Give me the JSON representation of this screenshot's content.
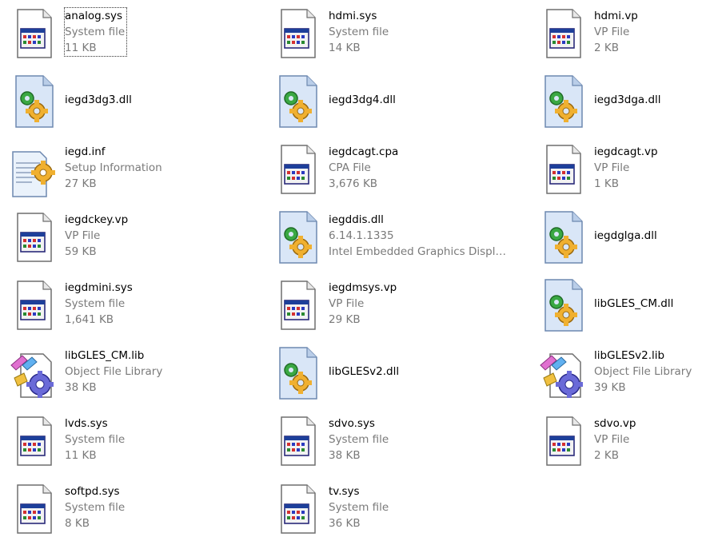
{
  "files": [
    {
      "name": "analog.sys",
      "line2": "System file",
      "line3": "11 KB",
      "icon": "system-file-icon",
      "selected": true
    },
    {
      "name": "hdmi.sys",
      "line2": "System file",
      "line3": "14 KB",
      "icon": "system-file-icon"
    },
    {
      "name": "hdmi.vp",
      "line2": "VP File",
      "line3": "2 KB",
      "icon": "system-file-icon"
    },
    {
      "name": "iegd3dg3.dll",
      "line2": "",
      "line3": "",
      "icon": "dll-file-icon"
    },
    {
      "name": "iegd3dg4.dll",
      "line2": "",
      "line3": "",
      "icon": "dll-file-icon"
    },
    {
      "name": "iegd3dga.dll",
      "line2": "",
      "line3": "",
      "icon": "dll-file-icon"
    },
    {
      "name": "iegd.inf",
      "line2": "Setup Information",
      "line3": "27 KB",
      "icon": "setup-info-icon"
    },
    {
      "name": "iegdcagt.cpa",
      "line2": "CPA File",
      "line3": "3,676 KB",
      "icon": "system-file-icon"
    },
    {
      "name": "iegdcagt.vp",
      "line2": "VP File",
      "line3": "1 KB",
      "icon": "system-file-icon"
    },
    {
      "name": "iegdckey.vp",
      "line2": "VP File",
      "line3": "59 KB",
      "icon": "system-file-icon"
    },
    {
      "name": "iegddis.dll",
      "line2": "6.14.1.1335",
      "line3": "Intel Embedded Graphics Displ…",
      "icon": "dll-file-icon"
    },
    {
      "name": "iegdglga.dll",
      "line2": "",
      "line3": "",
      "icon": "dll-file-icon"
    },
    {
      "name": "iegdmini.sys",
      "line2": "System file",
      "line3": "1,641 KB",
      "icon": "system-file-icon"
    },
    {
      "name": "iegdmsys.vp",
      "line2": "VP File",
      "line3": "29 KB",
      "icon": "system-file-icon"
    },
    {
      "name": "libGLES_CM.dll",
      "line2": "",
      "line3": "",
      "icon": "dll-file-icon"
    },
    {
      "name": "libGLES_CM.lib",
      "line2": "Object File Library",
      "line3": "38 KB",
      "icon": "library-file-icon"
    },
    {
      "name": "libGLESv2.dll",
      "line2": "",
      "line3": "",
      "icon": "dll-file-icon"
    },
    {
      "name": "libGLESv2.lib",
      "line2": "Object File Library",
      "line3": "39 KB",
      "icon": "library-file-icon"
    },
    {
      "name": "lvds.sys",
      "line2": "System file",
      "line3": "11 KB",
      "icon": "system-file-icon"
    },
    {
      "name": "sdvo.sys",
      "line2": "System file",
      "line3": "38 KB",
      "icon": "system-file-icon"
    },
    {
      "name": "sdvo.vp",
      "line2": "VP File",
      "line3": "2 KB",
      "icon": "system-file-icon"
    },
    {
      "name": "softpd.sys",
      "line2": "System file",
      "line3": "8 KB",
      "icon": "system-file-icon"
    },
    {
      "name": "tv.sys",
      "line2": "System file",
      "line3": "36 KB",
      "icon": "system-file-icon"
    }
  ],
  "colors": {
    "secondary_text": "#7a7a7a",
    "dll_page": "#d9e6f7",
    "gear": "#f0b030"
  }
}
